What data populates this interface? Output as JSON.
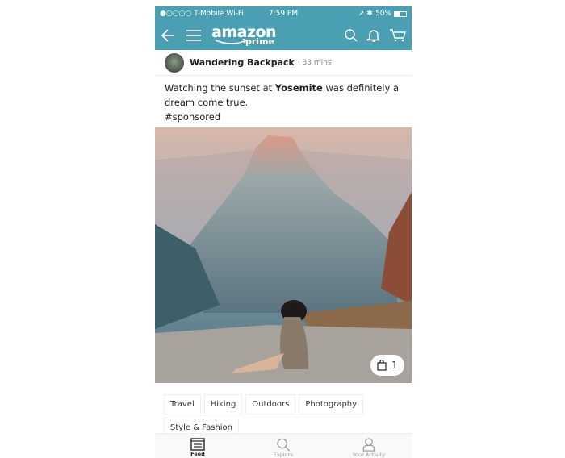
{
  "status_bar": {
    "carrier": "●○○○○ T-Mobile Wi-Fi",
    "time": "7:59 PM",
    "battery": "50%",
    "battery_level": 0.5
  },
  "nav": {
    "logo_text": "amazon",
    "logo_sub": "prime"
  },
  "post": {
    "author": "Wandering Backpack",
    "time": "· 33 mins",
    "caption_before": "Watching the sunset at ",
    "caption_bold": "Yosemite",
    "caption_after": " was definitely a dream come true.",
    "hashtag": "#sponsored",
    "product_count": "1",
    "tags": [
      "Travel",
      "Hiking",
      "Outdoors",
      "Photography",
      "Style & Fashion"
    ]
  },
  "tabbar": {
    "items": [
      {
        "label": "Feed"
      },
      {
        "label": "Explore"
      },
      {
        "label": "Your Activity"
      }
    ]
  },
  "colors": {
    "brand": "#4aa0b2"
  }
}
